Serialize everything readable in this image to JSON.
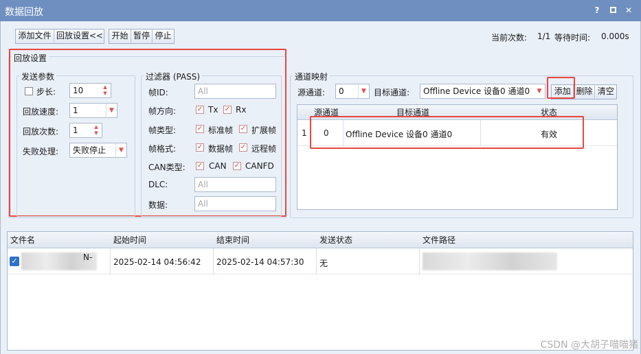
{
  "window": {
    "title": "数据回放",
    "help": "?",
    "maximize": "□",
    "close": "✕"
  },
  "toolbar": {
    "add_file": "添加文件",
    "replay_settings": "回放设置<<",
    "start": "开始",
    "pause": "暂停",
    "stop": "停止",
    "current_count_label": "当前次数:",
    "current_count_value": "1/1",
    "wait_time_label": "等待时间:",
    "wait_time_value": "0.000s"
  },
  "replay_settings": {
    "title": "回放设置",
    "send_params": {
      "title": "发送参数",
      "step_label": "步长:",
      "step_value": "10",
      "speed_label": "回放速度:",
      "speed_value": "1",
      "count_label": "回放次数:",
      "count_value": "1",
      "fail_label": "失败处理:",
      "fail_value": "失败停止"
    },
    "filter": {
      "title": "过滤器 (PASS)",
      "frame_id_label": "帧ID:",
      "frame_id_placeholder": "All",
      "direction_label": "帧方向:",
      "tx": "Tx",
      "rx": "Rx",
      "frame_type_label": "帧类型:",
      "std": "标准帧",
      "ext": "扩展帧",
      "frame_format_label": "帧格式:",
      "data_frame": "数据帧",
      "remote_frame": "远程帧",
      "can_type_label": "CAN类型:",
      "can": "CAN",
      "canfd": "CANFD",
      "dlc_label": "DLC:",
      "dlc_placeholder": "All",
      "data_label": "数据:",
      "data_placeholder": "All"
    }
  },
  "channel_map": {
    "title": "通道映射",
    "src_label": "源通道:",
    "src_value": "0",
    "dst_label": "目标通道:",
    "dst_value": "Offline Device 设备0 通道0",
    "add": "添加",
    "delete": "删除",
    "clear": "清空",
    "columns": [
      "源通道",
      "目标通道",
      "状态"
    ],
    "rows": [
      {
        "index": "1",
        "src": "0",
        "dst": "Offline Device 设备0 通道0",
        "status": "有效"
      }
    ]
  },
  "file_table": {
    "columns": [
      "文件名",
      "起始时间",
      "结束时间",
      "发送状态",
      "文件路径"
    ],
    "rows": [
      {
        "name": "N-",
        "start": "2025-02-14 04:56:42",
        "end": "2025-02-14 04:57:30",
        "status": "无",
        "path": ""
      }
    ]
  },
  "watermark": "CSDN @大胡子喵喵猪"
}
